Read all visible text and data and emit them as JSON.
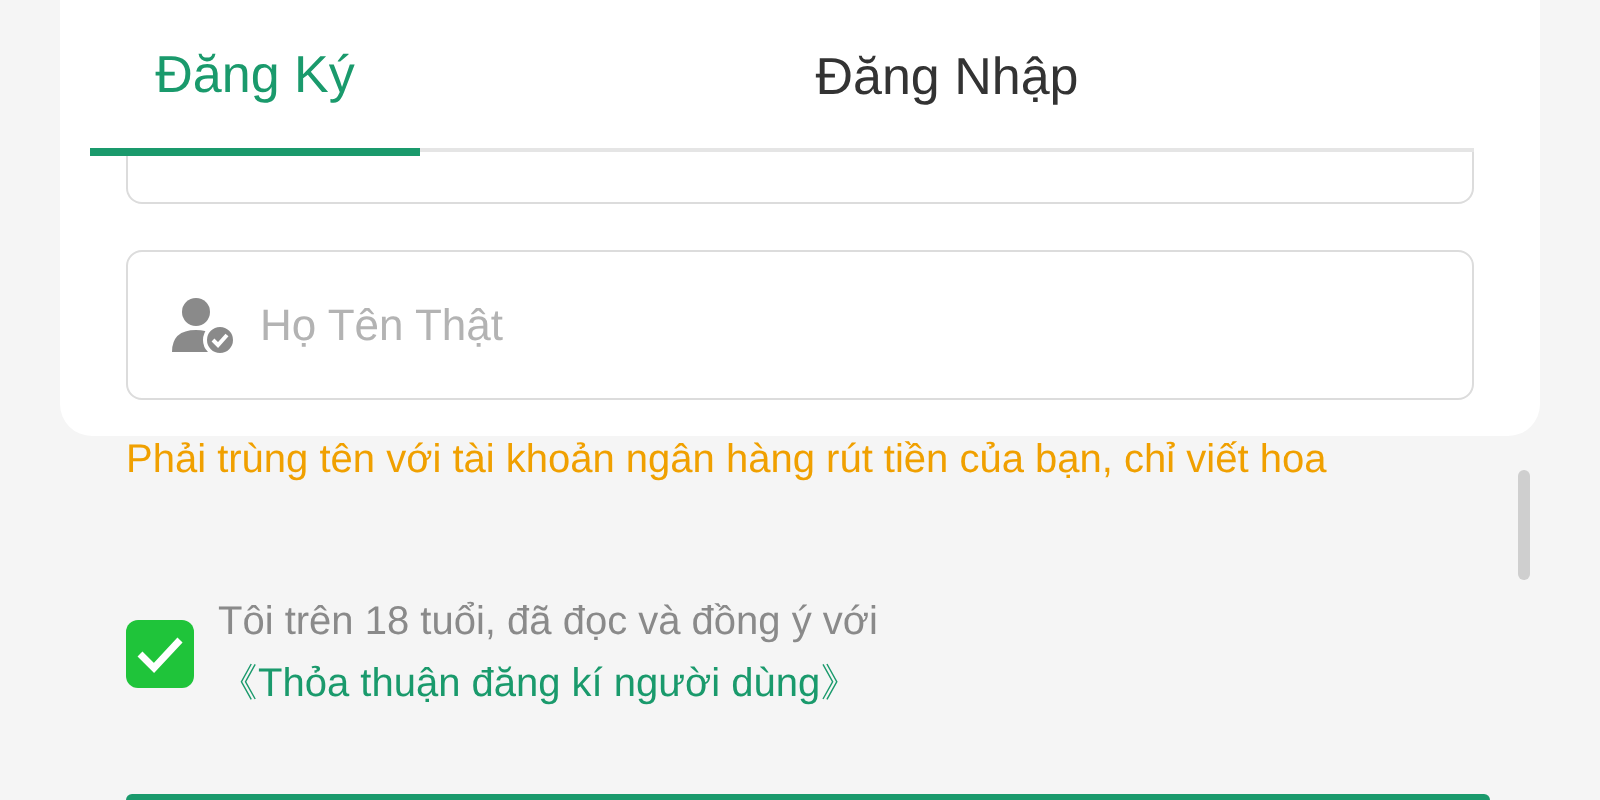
{
  "tabs": [
    {
      "label": "Đăng Ký",
      "selected": true
    },
    {
      "label": "Đăng Nhập",
      "selected": false
    }
  ],
  "name_field": {
    "placeholder": "Họ Tên Thật"
  },
  "hint": "Phải trùng tên với tài khoản ngân hàng rút tiền của bạn, chỉ viết hoa",
  "agreement": {
    "checked": true,
    "text": "Tôi trên 18 tuổi, đã đọc và đồng ý với",
    "link": "《Thỏa thuận đăng kí người dùng》"
  }
}
